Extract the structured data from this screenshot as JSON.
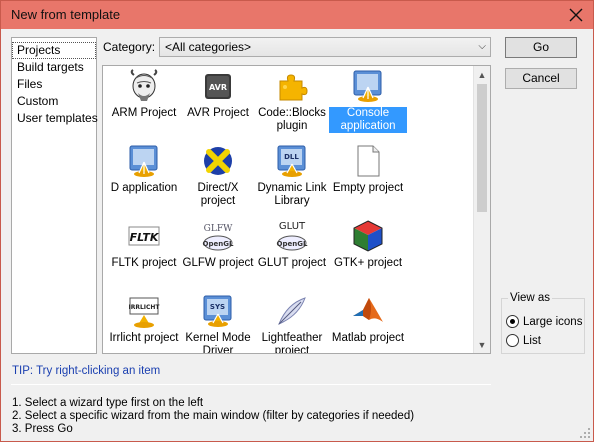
{
  "window": {
    "title": "New from template"
  },
  "wizard_types": [
    {
      "label": "Projects",
      "active": true
    },
    {
      "label": "Build targets"
    },
    {
      "label": "Files"
    },
    {
      "label": "Custom"
    },
    {
      "label": "User templates"
    }
  ],
  "category": {
    "label": "Category:",
    "value": "<All categories>"
  },
  "templates": [
    {
      "label": "ARM Project",
      "icon": "gnu-gnome-icon"
    },
    {
      "label": "AVR Project",
      "icon": "avr-chip-icon"
    },
    {
      "label": "Code::Blocks plugin",
      "icon": "puzzle-piece-icon"
    },
    {
      "label": "Console application",
      "icon": "console-app-icon",
      "selected": true
    },
    {
      "label": "D application",
      "icon": "d-app-icon"
    },
    {
      "label": "Direct/X project",
      "icon": "directx-icon"
    },
    {
      "label": "Dynamic Link Library",
      "icon": "dll-icon"
    },
    {
      "label": "Empty project",
      "icon": "blank-document-icon"
    },
    {
      "label": "FLTK project",
      "icon": "fltk-icon",
      "icon_text": "FLTK"
    },
    {
      "label": "GLFW project",
      "icon": "glfw-opengl-icon",
      "icon_text": "GLFW",
      "icon_badge": "OpenGL"
    },
    {
      "label": "GLUT project",
      "icon": "glut-opengl-icon",
      "icon_text": "GLUT",
      "icon_badge": "OpenGL"
    },
    {
      "label": "GTK+ project",
      "icon": "gtk-cube-icon"
    },
    {
      "label": "Irrlicht project",
      "icon": "irrlicht-icon",
      "icon_text": "IRRLICHT"
    },
    {
      "label": "Kernel Mode Driver",
      "icon": "kernel-driver-icon",
      "icon_text": "SYS"
    },
    {
      "label": "Lightfeather project",
      "icon": "feather-icon"
    },
    {
      "label": "Matlab project",
      "icon": "matlab-icon"
    }
  ],
  "buttons": {
    "go": "Go",
    "cancel": "Cancel"
  },
  "view_as": {
    "label": "View as",
    "options": [
      {
        "label": "Large icons",
        "checked": true
      },
      {
        "label": "List",
        "checked": false
      }
    ]
  },
  "tip": "TIP: Try right-clicking an item",
  "instructions": [
    "1. Select a wizard type first on the left",
    "2. Select a specific wizard from the main window (filter by categories if needed)",
    "3. Press Go"
  ],
  "colors": {
    "titlebar": "#e8766a",
    "selection": "#3399ff",
    "tip": "#1a3fb0"
  }
}
